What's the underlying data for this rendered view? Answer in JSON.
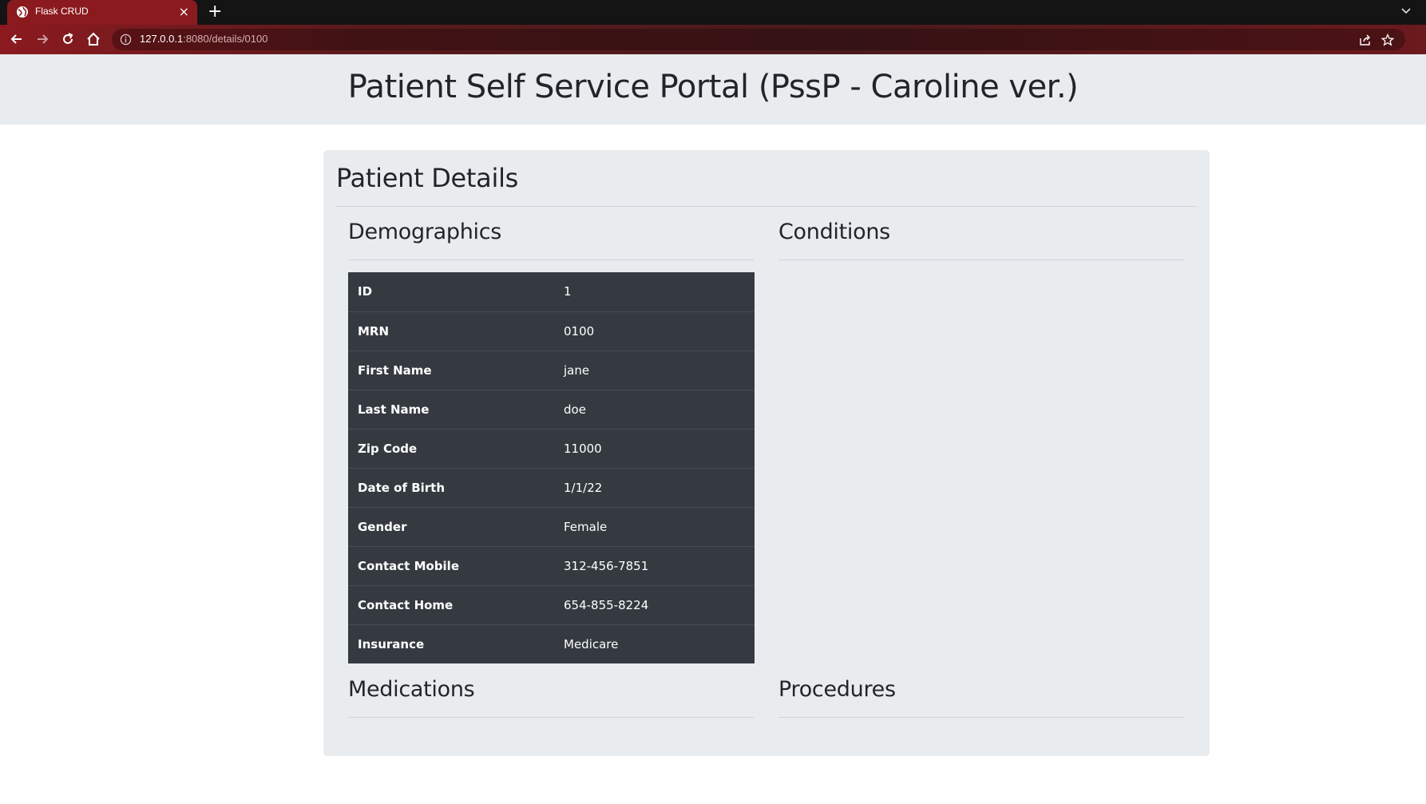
{
  "browser": {
    "tab_title": "Flask CRUD",
    "url_host": "127.0.0.1",
    "url_path": ":8080/details/0100"
  },
  "header": {
    "title": "Patient Self Service Portal (PssP - Caroline ver.)"
  },
  "card": {
    "title": "Patient Details",
    "sections": {
      "demographics": "Demographics",
      "conditions": "Conditions",
      "medications": "Medications",
      "procedures": "Procedures"
    }
  },
  "demographics": [
    {
      "label": "ID",
      "value": "1"
    },
    {
      "label": "MRN",
      "value": "0100"
    },
    {
      "label": "First Name",
      "value": "jane"
    },
    {
      "label": "Last Name",
      "value": "doe"
    },
    {
      "label": "Zip Code",
      "value": "11000"
    },
    {
      "label": "Date of Birth",
      "value": "1/1/22"
    },
    {
      "label": "Gender",
      "value": "Female"
    },
    {
      "label": "Contact Mobile",
      "value": "312-456-7851"
    },
    {
      "label": "Contact Home",
      "value": "654-855-8224"
    },
    {
      "label": "Insurance",
      "value": "Medicare"
    }
  ]
}
